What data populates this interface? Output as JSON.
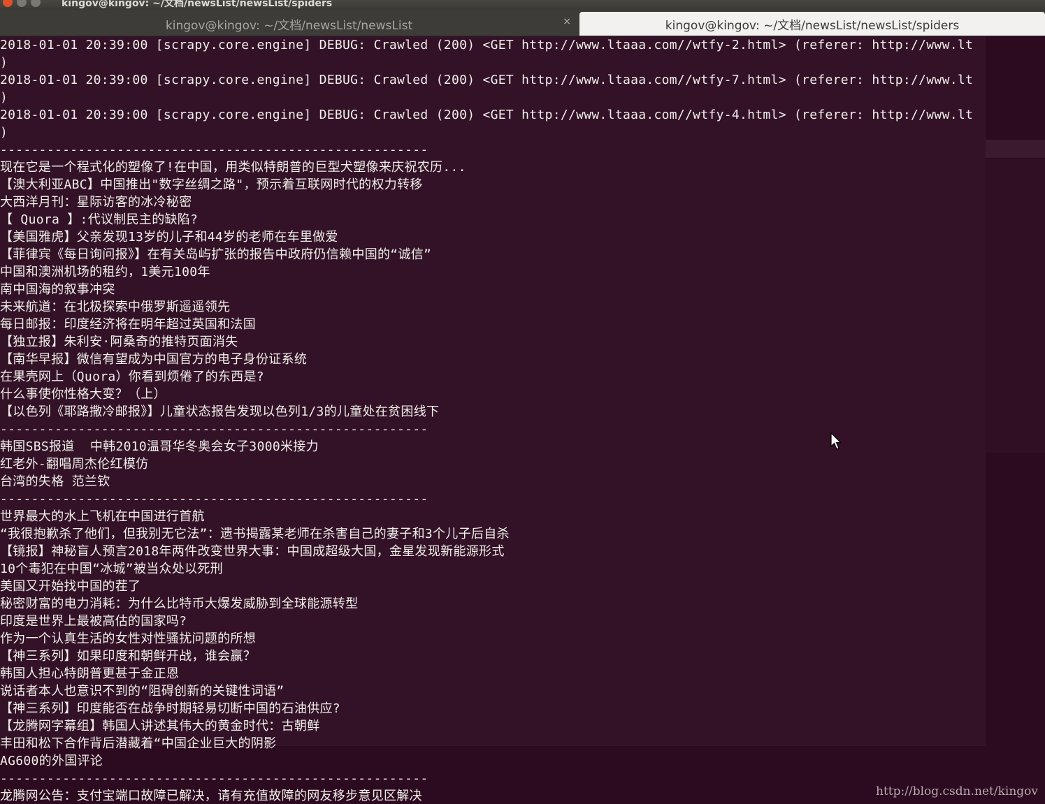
{
  "window": {
    "title": "kingov@kingov: ~/文档/newsList/newsList/spiders"
  },
  "tabs": [
    {
      "label": "kingov@kingov: ~/文档/newsList/newsList",
      "close": "×",
      "active": false
    },
    {
      "label": "kingov@kingov: ~/文档/newsList/newsList/spiders",
      "active": true
    }
  ],
  "terminal": {
    "lines": [
      "2018-01-01 20:39:00 [scrapy.core.engine] DEBUG: Crawled (200) <GET http://www.ltaaa.com//wtfy-2.html> (referer: http://www.lt",
      ")",
      "2018-01-01 20:39:00 [scrapy.core.engine] DEBUG: Crawled (200) <GET http://www.ltaaa.com//wtfy-7.html> (referer: http://www.lt",
      ")",
      "2018-01-01 20:39:00 [scrapy.core.engine] DEBUG: Crawled (200) <GET http://www.ltaaa.com//wtfy-4.html> (referer: http://www.lt",
      ")",
      "-------------------------------------------------------",
      "现在它是一个程式化的塑像了!在中国，用类似特朗普的巨型犬塑像来庆祝农历...",
      "【澳大利亚ABC】中国推出\"数字丝绸之路\"，预示着互联网时代的权力转移",
      "大西洋月刊：星际访客的冰冷秘密",
      "【 Quora 】:代议制民主的缺陷?",
      "【美国雅虎】父亲发现13岁的儿子和44岁的老师在车里做爱",
      "【菲律宾《每日询问报》】在有关岛屿扩张的报告中政府仍信赖中国的“诚信”",
      "中国和澳洲机场的租约，1美元100年",
      "南中国海的叙事冲突",
      "未来航道：在北极探索中俄罗斯遥遥领先",
      "每日邮报：印度经济将在明年超过英国和法国",
      "【独立报】朱利安·阿桑奇的推特页面消失",
      "【南华早报】微信有望成为中国官方的电子身份证系统",
      "在果壳网上（Quora）你看到烦倦了的东西是?",
      "什么事使你性格大变？（上）",
      "【以色列《耶路撒冷邮报》】儿童状态报告发现以色列1/3的儿童处在贫困线下",
      "-------------------------------------------------------",
      "韩国SBS报道  中韩2010温哥华冬奥会女子3000米接力",
      "红老外-翻唱周杰伦红模仿",
      "台湾的失格 范兰钦",
      "-------------------------------------------------------",
      "世界最大的水上飞机在中国进行首航",
      "“我很抱歉杀了他们，但我别无它法”：遗书揭露某老师在杀害自己的妻子和3个儿子后自杀",
      "【镜报】神秘盲人预言2018年两件改变世界大事：中国成超级大国，金星发现新能源形式",
      "10个毒犯在中国“冰城”被当众处以死刑",
      "美国又开始找中国的茬了",
      "秘密财富的电力消耗：为什么比特币大爆发威胁到全球能源转型",
      "印度是世界上最被高估的国家吗?",
      "作为一个认真生活的女性对性骚扰问题的所想",
      "【神三系列】如果印度和朝鲜开战，谁会赢？",
      "韩国人担心特朗普更甚于金正恩",
      "说话者本人也意识不到的“阻碍创新的关键性词语”",
      "【神三系列】印度能否在战争时期轻易切断中国的石油供应?",
      "【龙腾网字幕组】韩国人讲述其伟大的黄金时代：古朝鲜",
      "丰田和松下合作背后潜藏着“中国企业巨大的阴影",
      "AG600的外国评论",
      "-------------------------------------------------------",
      "龙腾网公告：支付宝端口故障已解决，请有充值故障的网友移步意见区解决"
    ]
  },
  "watermark": "http://blog.csdn.net/kingov"
}
